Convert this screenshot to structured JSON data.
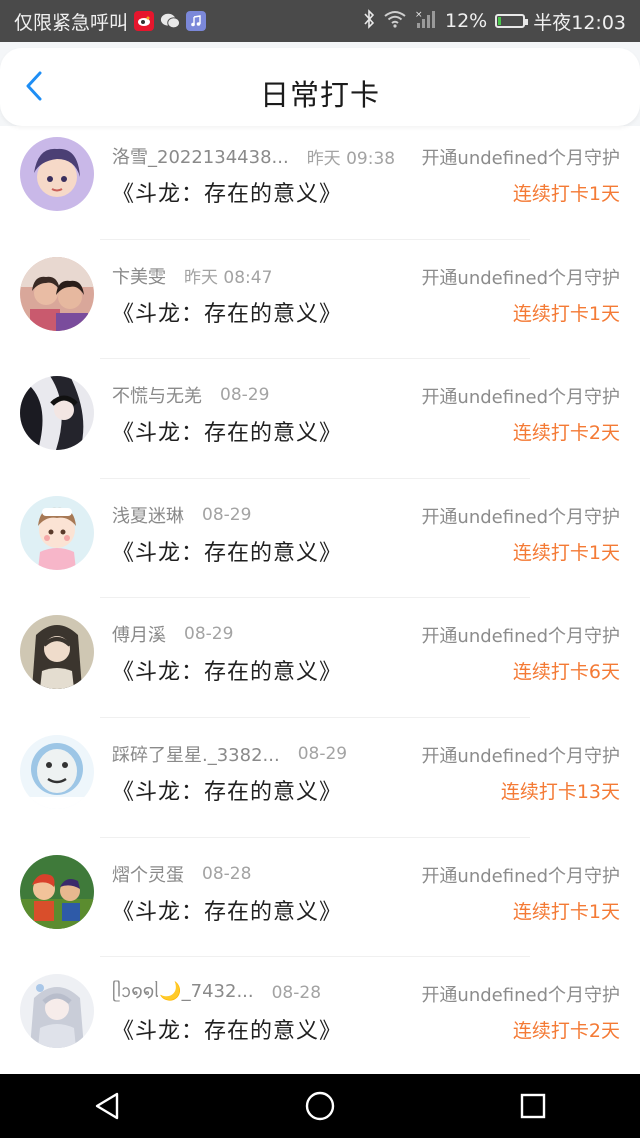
{
  "status_bar": {
    "carrier": "仅限紧急呼叫",
    "signal_mark": "×",
    "battery_pct": "12%",
    "time": "半夜12:03",
    "icons": [
      "weibo-icon",
      "wechat-icon",
      "music-icon",
      "bluetooth-icon",
      "wifi-icon",
      "signal-icon",
      "battery-icon"
    ],
    "battery_level": 0.12
  },
  "header": {
    "title": "日常打卡",
    "back_icon": "chevron-left-icon",
    "accent": "#1e8ef5"
  },
  "colors": {
    "streak": "#f47a35",
    "muted": "#8c8c8c"
  },
  "list": [
    {
      "name": "洛雪_2022134438...",
      "time": "昨天 09:38",
      "book": "《斗龙：存在的意义》",
      "guard": "开通undefined个月守护",
      "streak": "连续打卡1天"
    },
    {
      "name": "卞美雯",
      "time": "昨天 08:47",
      "book": "《斗龙：存在的意义》",
      "guard": "开通undefined个月守护",
      "streak": "连续打卡1天"
    },
    {
      "name": "不慌与无羌",
      "time": "08-29",
      "book": "《斗龙：存在的意义》",
      "guard": "开通undefined个月守护",
      "streak": "连续打卡2天"
    },
    {
      "name": "浅夏迷琳",
      "time": "08-29",
      "book": "《斗龙：存在的意义》",
      "guard": "开通undefined个月守护",
      "streak": "连续打卡1天"
    },
    {
      "name": "傅月溪",
      "time": "08-29",
      "book": "《斗龙：存在的意义》",
      "guard": "开通undefined个月守护",
      "streak": "连续打卡6天"
    },
    {
      "name": "踩碎了星星._3382...",
      "time": "08-29",
      "book": "《斗龙：存在的意义》",
      "guard": "开通undefined个月守护",
      "streak": "连续打卡13天"
    },
    {
      "name": "熠个灵蛋",
      "time": "08-28",
      "book": "《斗龙：存在的意义》",
      "guard": "开通undefined个月守护",
      "streak": "连续打卡1天"
    },
    {
      "name": "ᥫᩣ໑໑ᥣ🌙_7432...",
      "time": "08-28",
      "book": "《斗龙：存在的意义》",
      "guard": "开通undefined个月守护",
      "streak": "连续打卡2天"
    }
  ],
  "nav_bar": {
    "icons": [
      "back-triangle-icon",
      "home-circle-icon",
      "recents-square-icon"
    ]
  }
}
